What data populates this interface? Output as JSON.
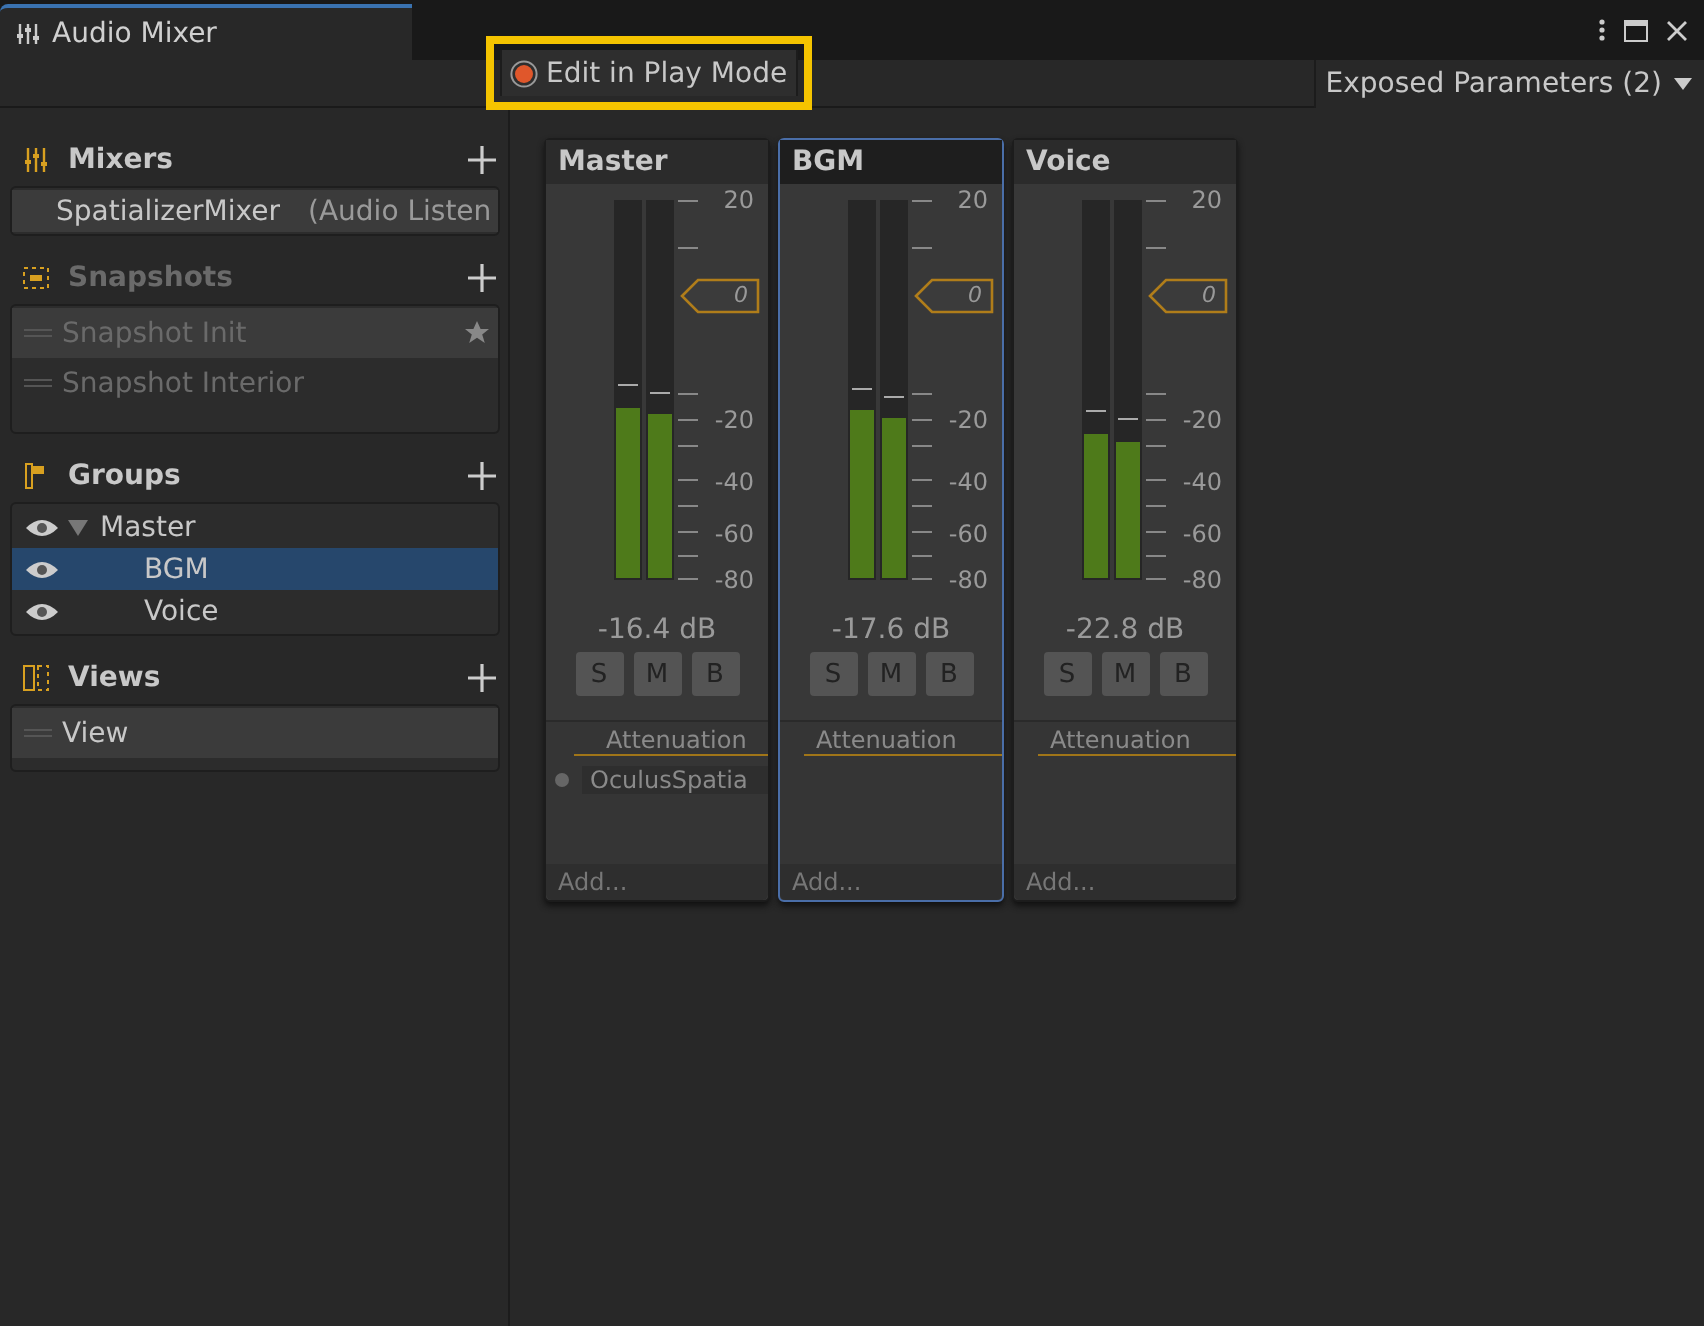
{
  "window": {
    "title": "Audio Mixer"
  },
  "toolbar": {
    "edit_in_play_mode": {
      "label": "Edit in Play Mode",
      "highlighted": true
    },
    "exposed_parameters": "Exposed Parameters (2)"
  },
  "sections": [
    {
      "title": "Mixers",
      "kind": "mixers",
      "disabled": false,
      "items": [
        {
          "name": "SpatializerMixer",
          "detail": "(Audio Listen",
          "selected": true
        }
      ]
    },
    {
      "title": "Snapshots",
      "kind": "snapshots",
      "disabled": true,
      "items": [
        {
          "name": "Snapshot Init",
          "starred": true,
          "selected": true
        },
        {
          "name": "Snapshot Interior",
          "starred": false,
          "selected": false
        }
      ]
    },
    {
      "title": "Groups",
      "kind": "groups",
      "disabled": false,
      "items": [
        {
          "name": "Master",
          "expanded": true,
          "selected": false,
          "children": [
            {
              "name": "BGM",
              "selected": true
            },
            {
              "name": "Voice",
              "selected": false
            }
          ]
        }
      ]
    },
    {
      "title": "Views",
      "kind": "views",
      "disabled": false,
      "items": [
        {
          "name": "View",
          "selected": true
        }
      ]
    }
  ],
  "strips": [
    {
      "name": "Master",
      "selected": false,
      "fader": "0",
      "scale_labels": [
        "20",
        "-20",
        "-40",
        "-60",
        "-80"
      ],
      "meters": [
        {
          "level": 0.45
        },
        {
          "level": 0.43
        }
      ],
      "reading": "-16.4 dB",
      "buttons": [
        "S",
        "M",
        "B"
      ],
      "effects": [
        {
          "name": "Attenuation",
          "kind": "header"
        },
        {
          "name": "OculusSpatia",
          "kind": "plugin"
        }
      ],
      "add": "Add..."
    },
    {
      "name": "BGM",
      "selected": true,
      "fader": "0",
      "scale_labels": [
        "20",
        "-20",
        "-40",
        "-60",
        "-80"
      ],
      "meters": [
        {
          "level": 0.44
        },
        {
          "level": 0.42
        }
      ],
      "reading": "-17.6 dB",
      "buttons": [
        "S",
        "M",
        "B"
      ],
      "effects": [
        {
          "name": "Attenuation",
          "kind": "header"
        }
      ],
      "add": "Add..."
    },
    {
      "name": "Voice",
      "selected": false,
      "fader": "0",
      "scale_labels": [
        "20",
        "-20",
        "-40",
        "-60",
        "-80"
      ],
      "meters": [
        {
          "level": 0.38
        },
        {
          "level": 0.36
        }
      ],
      "reading": "-22.8 dB",
      "buttons": [
        "S",
        "M",
        "B"
      ],
      "effects": [
        {
          "name": "Attenuation",
          "kind": "header"
        }
      ],
      "add": "Add..."
    }
  ]
}
